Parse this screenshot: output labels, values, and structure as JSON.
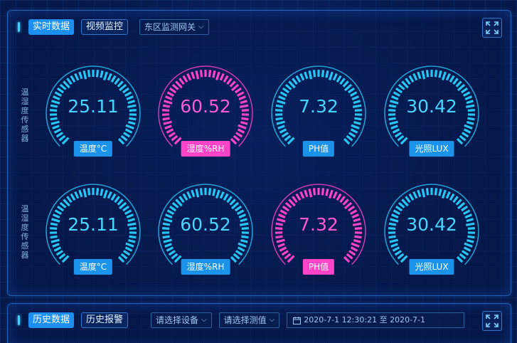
{
  "realtime": {
    "tabs": [
      "实时数据",
      "视频监控"
    ],
    "gateway": "东区监测网关",
    "rows": [
      {
        "label": "温湿度传感器",
        "gauges": [
          {
            "value": "25.11",
            "label": "温度°C",
            "color": "blue"
          },
          {
            "value": "60.52",
            "label": "湿度%RH",
            "color": "pink"
          },
          {
            "value": "7.32",
            "label": "PH值",
            "color": "blue"
          },
          {
            "value": "30.42",
            "label": "光照LUX",
            "color": "blue"
          }
        ]
      },
      {
        "label": "温湿度传感器",
        "gauges": [
          {
            "value": "25.11",
            "label": "温度°C",
            "color": "blue"
          },
          {
            "value": "60.52",
            "label": "湿度%RH",
            "color": "blue"
          },
          {
            "value": "7.32",
            "label": "PH值",
            "color": "pink"
          },
          {
            "value": "30.42",
            "label": "光照LUX",
            "color": "blue"
          }
        ]
      }
    ]
  },
  "history": {
    "tabs": [
      "历史数据",
      "历史报警"
    ],
    "device_placeholder": "请选择设备",
    "metric_placeholder": "请选择测值",
    "date_range": "2020-7-1 12:30:21 至 2020-7-1"
  },
  "colors": {
    "blue": "#27c6f5",
    "pink": "#ff44c8",
    "accent": "#1d8ff0"
  },
  "icons": [
    "expand-icon",
    "calendar-icon",
    "chevron-down-icon"
  ]
}
